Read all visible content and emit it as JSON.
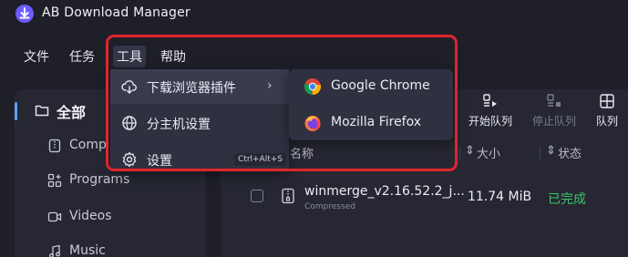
{
  "app": {
    "title": "AB Download Manager",
    "accent_color": "#5aa2ff"
  },
  "menubar": [
    {
      "label": "文件"
    },
    {
      "label": "任务"
    },
    {
      "label": "工具"
    },
    {
      "label": "帮助"
    }
  ],
  "tools_menu": {
    "items": [
      {
        "label": "下载浏览器插件",
        "icon": "cloud-download-icon"
      },
      {
        "label": "分主机设置",
        "icon": "globe-icon"
      },
      {
        "label": "设置",
        "icon": "gear-icon",
        "shortcut": "Ctrl+Alt+S"
      }
    ]
  },
  "browser_submenu": {
    "items": [
      {
        "label": "Google Chrome",
        "icon": "chrome-icon"
      },
      {
        "label": "Mozilla Firefox",
        "icon": "firefox-icon"
      }
    ]
  },
  "sidebar": {
    "all_label": "全部",
    "items": [
      {
        "label": "Comp",
        "icon": "compressed-icon"
      },
      {
        "label": "Programs",
        "icon": "programs-icon"
      },
      {
        "label": "Videos",
        "icon": "video-icon"
      },
      {
        "label": "Music",
        "icon": "music-icon"
      }
    ]
  },
  "toolbar": {
    "start_queue": "开始队列",
    "stop_queue": "停止队列",
    "queue": "队列"
  },
  "table": {
    "headers": {
      "name": "名称",
      "size": "大小",
      "status": "状态"
    },
    "rows": [
      {
        "name": "winmerge_v2.16.52.2_j...",
        "type": "Compressed",
        "size": "11.74 MiB",
        "status": "已完成",
        "status_color": "#3fc56a"
      }
    ]
  }
}
